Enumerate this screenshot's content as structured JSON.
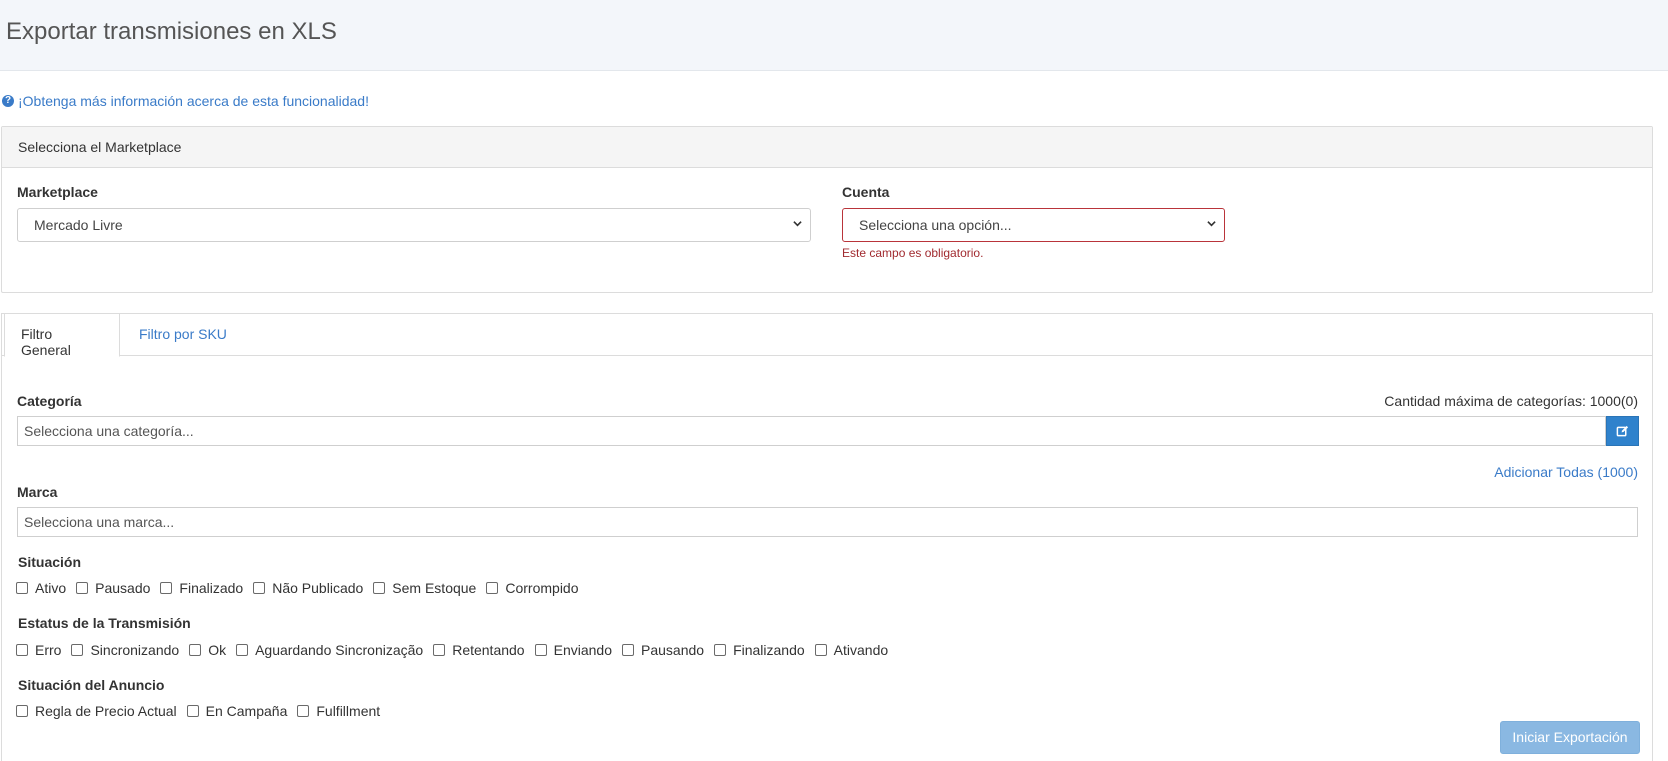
{
  "header": {
    "title": "Exportar transmisiones en XLS"
  },
  "help": {
    "text": "¡Obtenga más información acerca de esta funcionalidad!",
    "icon": "question-circle-icon"
  },
  "marketplace_panel": {
    "title": "Selecciona el Marketplace",
    "marketplace": {
      "label": "Marketplace",
      "value": "Mercado Livre"
    },
    "cuenta": {
      "label": "Cuenta",
      "value": "Selecciona una opción...",
      "error": "Este campo es obligatorio."
    }
  },
  "tabs": [
    {
      "label": "Filtro General",
      "active": true
    },
    {
      "label": "Filtro por SKU",
      "active": false
    }
  ],
  "categoria": {
    "label": "Categoría",
    "placeholder": "Selecciona una categoría...",
    "max_text": "Cantidad máxima de categorías: 1000(0)",
    "add_all": "Adicionar Todas (1000)"
  },
  "marca": {
    "label": "Marca",
    "placeholder": "Selecciona una marca..."
  },
  "situacion": {
    "label": "Situación",
    "options": [
      "Ativo",
      "Pausado",
      "Finalizado",
      "Não Publicado",
      "Sem Estoque",
      "Corrompido"
    ]
  },
  "estatus": {
    "label": "Estatus de la Transmisión",
    "options": [
      "Erro",
      "Sincronizando",
      "Ok",
      "Aguardando Sincronização",
      "Retentando",
      "Enviando",
      "Pausando",
      "Finalizando",
      "Ativando"
    ]
  },
  "situacion_anuncio": {
    "label": "Situación del Anuncio",
    "options": [
      "Regla de Precio Actual",
      "En Campaña",
      "Fulfillment"
    ]
  },
  "actions": {
    "export": "Iniciar Exportación"
  },
  "colors": {
    "accent": "#3a7bc8",
    "error": "#b9343a",
    "button_disabled": "#8ab8e2"
  }
}
